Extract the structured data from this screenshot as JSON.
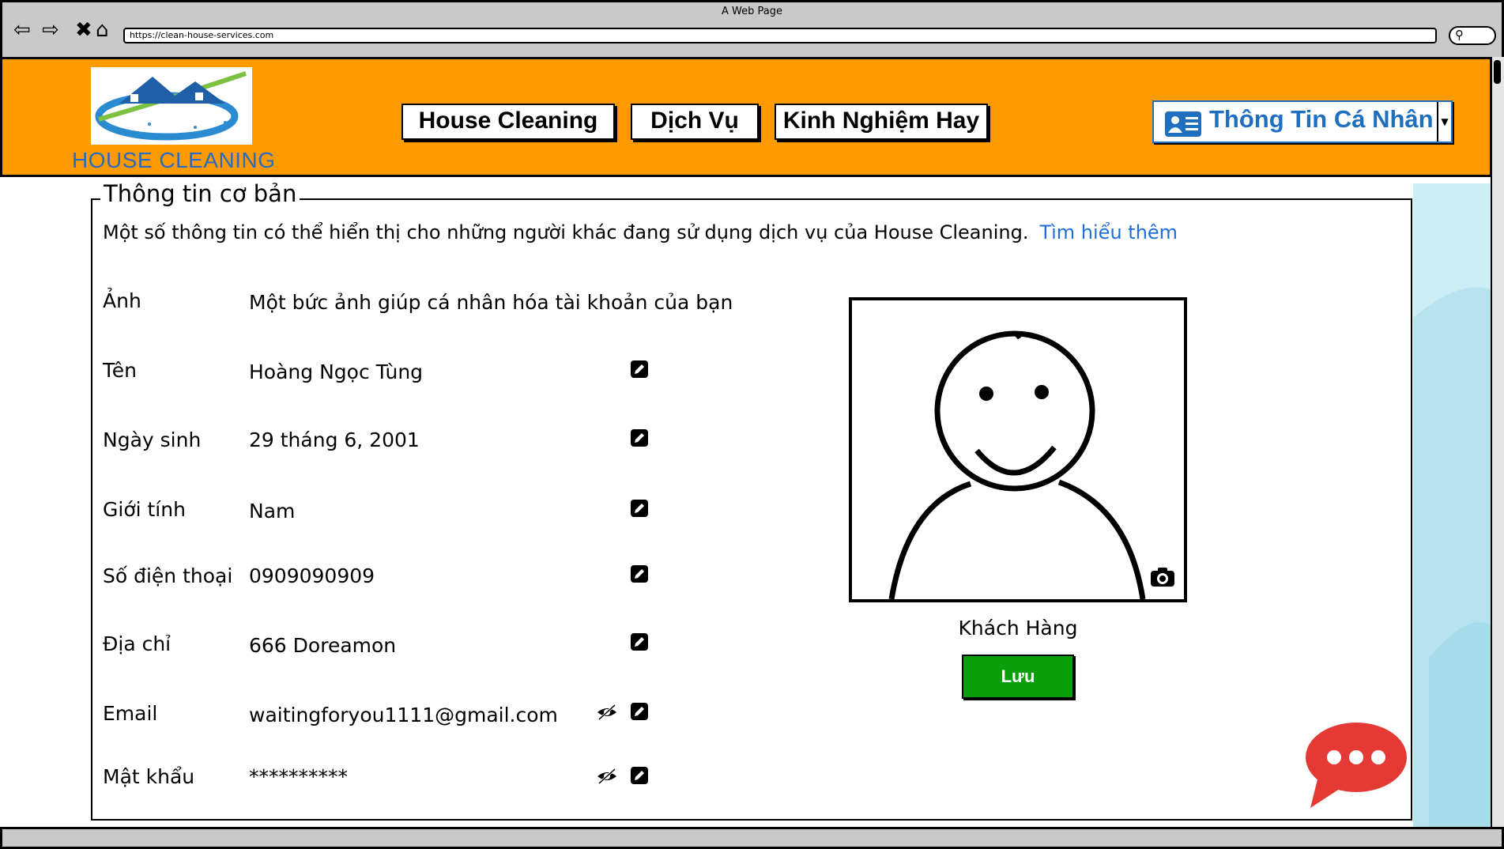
{
  "window": {
    "title": "A Web Page",
    "url": "https://clean-house-services.com"
  },
  "header": {
    "brand": "HOUSE CLEANING",
    "nav": [
      {
        "label": "House Cleaning"
      },
      {
        "label": "Dịch Vụ"
      },
      {
        "label": "Kinh Nghiệm Hay"
      }
    ],
    "profile_label": "Thông Tin Cá Nhân"
  },
  "section": {
    "title": "Thông tin cơ bản",
    "intro": "Một số thông tin có thể hiển thị cho những người khác đang sử dụng dịch vụ của House Cleaning.",
    "learn_more": "Tìm hiểu thêm"
  },
  "fields": {
    "photo": {
      "label": "Ảnh",
      "value": "Một bức ảnh giúp cá nhân hóa tài khoản của bạn"
    },
    "name": {
      "label": "Tên",
      "value": "Hoàng Ngọc Tùng"
    },
    "dob": {
      "label": "Ngày sinh",
      "value": "29 tháng 6, 2001"
    },
    "gender": {
      "label": "Giới tính",
      "value": "Nam"
    },
    "phone": {
      "label": "Số điện thoại",
      "value": "0909090909"
    },
    "address": {
      "label": "Địa chỉ",
      "value": "666 Doreamon"
    },
    "email": {
      "label": "Email",
      "value": "waitingforyou1111@gmail.com"
    },
    "password": {
      "label": "Mật khẩu",
      "value": "**********"
    }
  },
  "profile_card": {
    "role": "Khách Hàng",
    "save_label": "Lưu"
  },
  "colors": {
    "header_bg": "#ff9a00",
    "brand": "#2a6bc2",
    "link": "#1e6fd9",
    "save_bg": "#0a9e0a",
    "chat_bubble": "#e53935",
    "side_deco": "#b7e3ef"
  },
  "icons": [
    "back-arrow-icon",
    "forward-arrow-icon",
    "stop-icon",
    "home-icon",
    "search-icon",
    "id-card-icon",
    "edit-icon",
    "eye-slash-icon",
    "camera-icon",
    "chat-icon"
  ]
}
